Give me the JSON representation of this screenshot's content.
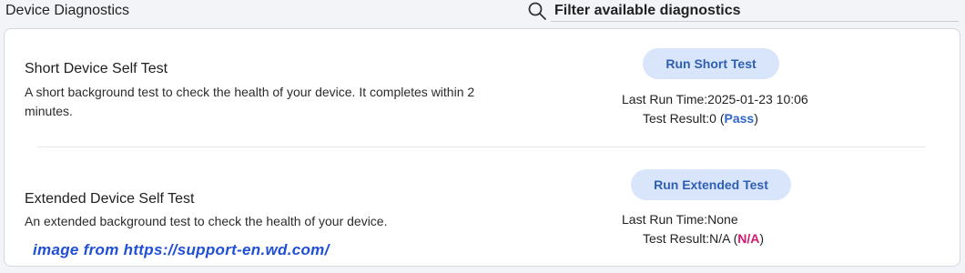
{
  "header": {
    "title": "Device Diagnostics",
    "filter_label": "Filter available diagnostics"
  },
  "tests": [
    {
      "title": "Short Device Self Test",
      "description": "A short background test to check the health of your device. It completes within 2 minutes.",
      "button_label": "Run Short Test",
      "last_run_label": "Last Run Time:",
      "last_run_value": "2025-01-23 10:06",
      "result_label": "Test Result:",
      "result_code": "0",
      "result_status": "Pass",
      "result_color": "#2f66c6"
    },
    {
      "title": "Extended Device Self Test",
      "description": "An extended background test to check the health of your device.",
      "button_label": "Run Extended Test",
      "last_run_label": "Last Run Time:",
      "last_run_value": "None",
      "result_label": "Test Result:",
      "result_code": "N/A",
      "result_status": "N/A",
      "result_color": "#d5196e"
    }
  ],
  "watermark": "image from https://support-en.wd.com/",
  "colors": {
    "button_bg": "#d9e5fb",
    "button_text": "#2f5fb3",
    "watermark": "#1f4fd6"
  }
}
